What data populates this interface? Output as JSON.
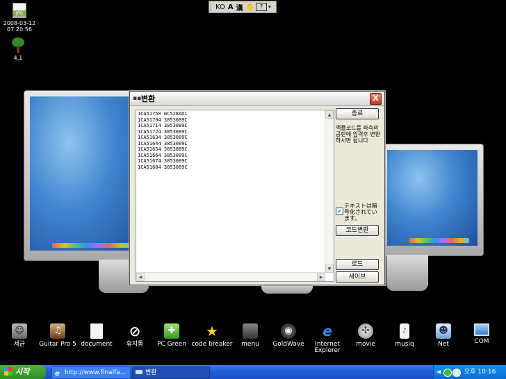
{
  "desktop_top": {
    "jpg_icon_text": "JPG",
    "jpg_label_line1": "2008-03-12",
    "jpg_label_line2": "07:20:56",
    "tree_label": "4,1"
  },
  "language_bar": {
    "lang": "KO",
    "glyph_a": "A",
    "glyph_han": "漢",
    "glyph_help": "?"
  },
  "dialog": {
    "title": "변환",
    "close_label": "X",
    "code_lines": [
      "1CA51758 0C528AD1",
      "1CA51704 3853089C",
      "1CA51714 3853089C",
      "1CA51724 3853089C",
      "1CA51634 3853089C",
      "1CA51644 3853089C",
      "1CA51654 3853089C",
      "1CA51664 3853089C",
      "1CA51674 3853089C",
      "1CA51684 3853089C"
    ],
    "buttons": {
      "exit": "종료",
      "convert": "코드변환",
      "load": "로드",
      "save": "세이브"
    },
    "instruction": "액플코드를 좌측의 공란에 입력후 변환하시면 됩니다",
    "checkbox_label": "テキストは暗号化されています。"
  },
  "dock": [
    {
      "label": "세균",
      "icon": "finder-icon"
    },
    {
      "label": "Guitar Pro 5",
      "icon": "guitar-pro-icon"
    },
    {
      "label": "document",
      "icon": "document-icon"
    },
    {
      "label": "휴지통",
      "icon": "trash-icon"
    },
    {
      "label": "PC Green",
      "icon": "pc-green-icon"
    },
    {
      "label": "code breaker",
      "icon": "star-icon"
    },
    {
      "label": "menu",
      "icon": "apple-menu-icon"
    },
    {
      "label": "GoldWave",
      "icon": "goldwave-icon"
    },
    {
      "label": "Internet Explorer",
      "icon": "ie-icon"
    },
    {
      "label": "movie",
      "icon": "movie-reel-icon"
    },
    {
      "label": "musiq",
      "icon": "music-player-icon"
    },
    {
      "label": "Net",
      "icon": "net-icon"
    },
    {
      "label": "COM",
      "icon": "computer-icon"
    }
  ],
  "taskbar": {
    "start_label": "시작",
    "task_ie": "http://www.finalfa...",
    "task_dialog": "변환",
    "clock": "오후 10:16"
  },
  "colors": {
    "taskbar_blue": "#245edb",
    "start_green": "#3c9a2c",
    "close_red": "#c0391b"
  }
}
